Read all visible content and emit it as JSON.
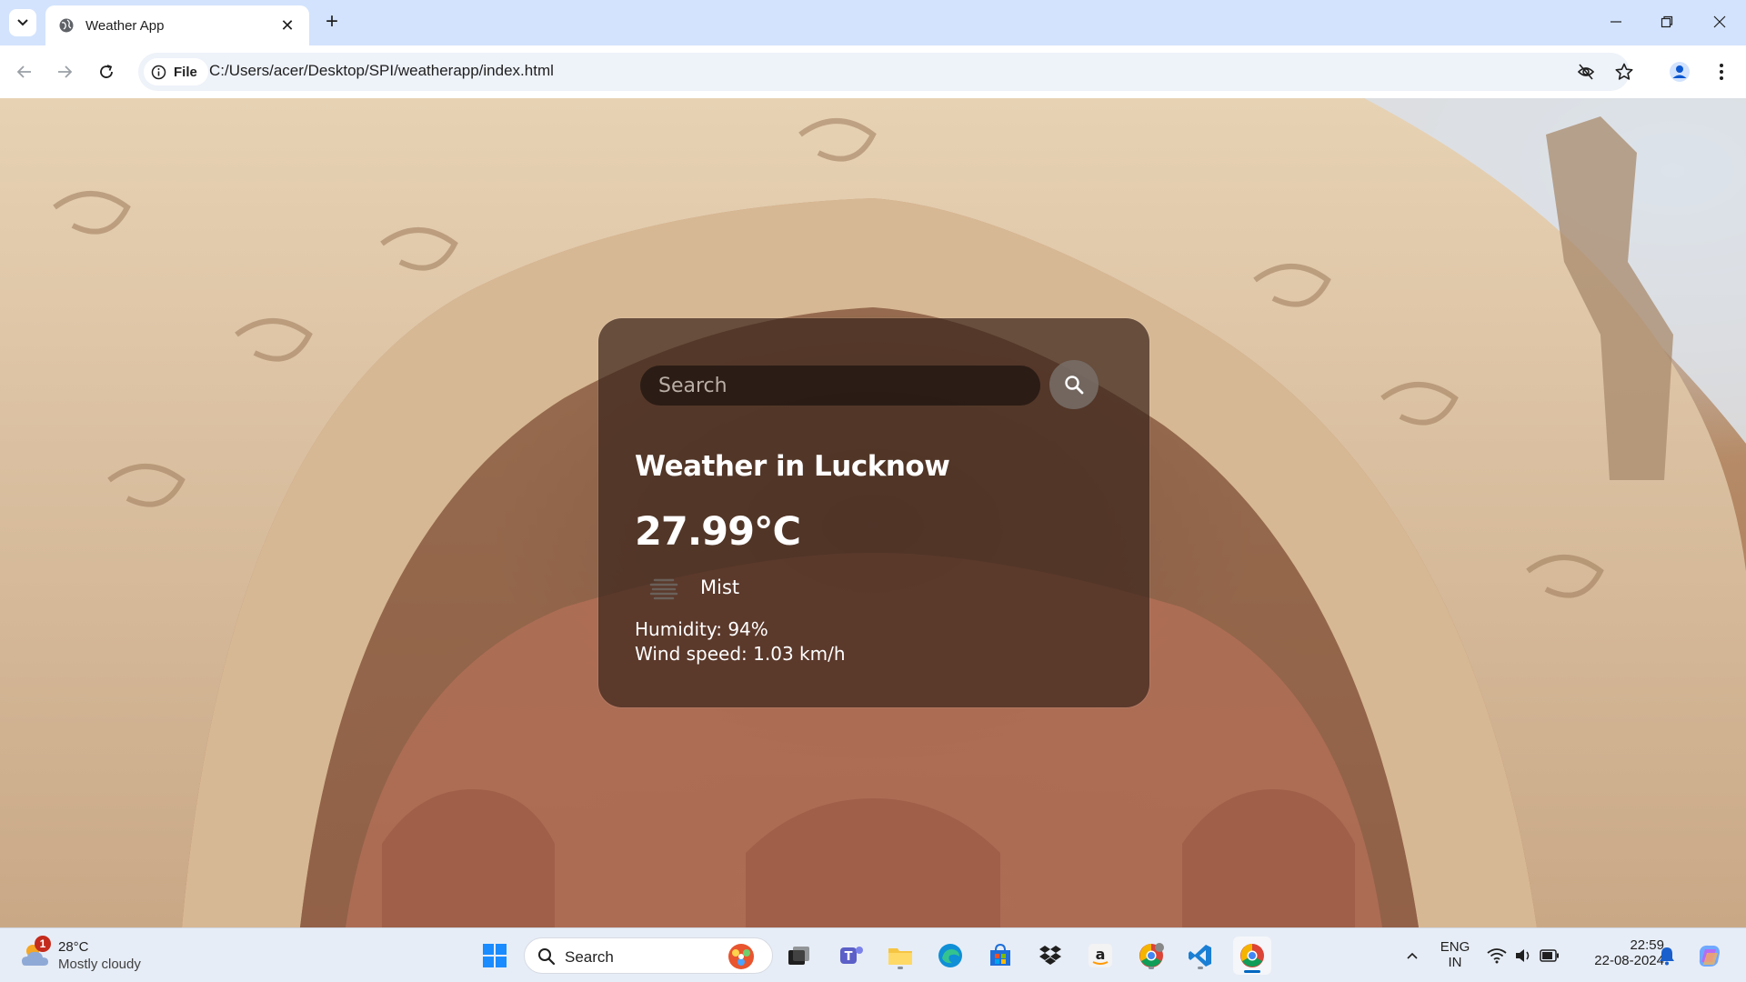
{
  "browser": {
    "tab_title": "Weather App",
    "new_tab_label": "+",
    "close_tab_label": "✕",
    "url_chip_label": "File",
    "url": "C:/Users/acer/Desktop/SPI/weatherapp/index.html"
  },
  "weather_card": {
    "search_placeholder": "Search",
    "city_heading": "Weather in Lucknow",
    "temperature": "27.99°C",
    "condition": "Mist",
    "condition_icon": "mist-icon",
    "humidity": "Humidity: 94%",
    "wind": "Wind speed: 1.03 km/h"
  },
  "taskbar": {
    "weather_temp": "28°C",
    "weather_desc": "Mostly cloudy",
    "weather_badge": "1",
    "search_label": "Search",
    "lang_line1": "ENG",
    "lang_line2": "IN",
    "time": "22:59",
    "date": "22-08-2024",
    "pinned_apps": [
      "windows-start",
      "search",
      "copilot-buddy",
      "task-view",
      "teams",
      "file-explorer",
      "edge",
      "microsoft-store",
      "dropbox",
      "amazon",
      "chrome-profile",
      "vscode",
      "chrome"
    ]
  },
  "colors": {
    "tab_strip": "#d3e3fd",
    "card_bg": "rgba(60,38,28,0.72)",
    "accent_blue": "#0067c0"
  }
}
